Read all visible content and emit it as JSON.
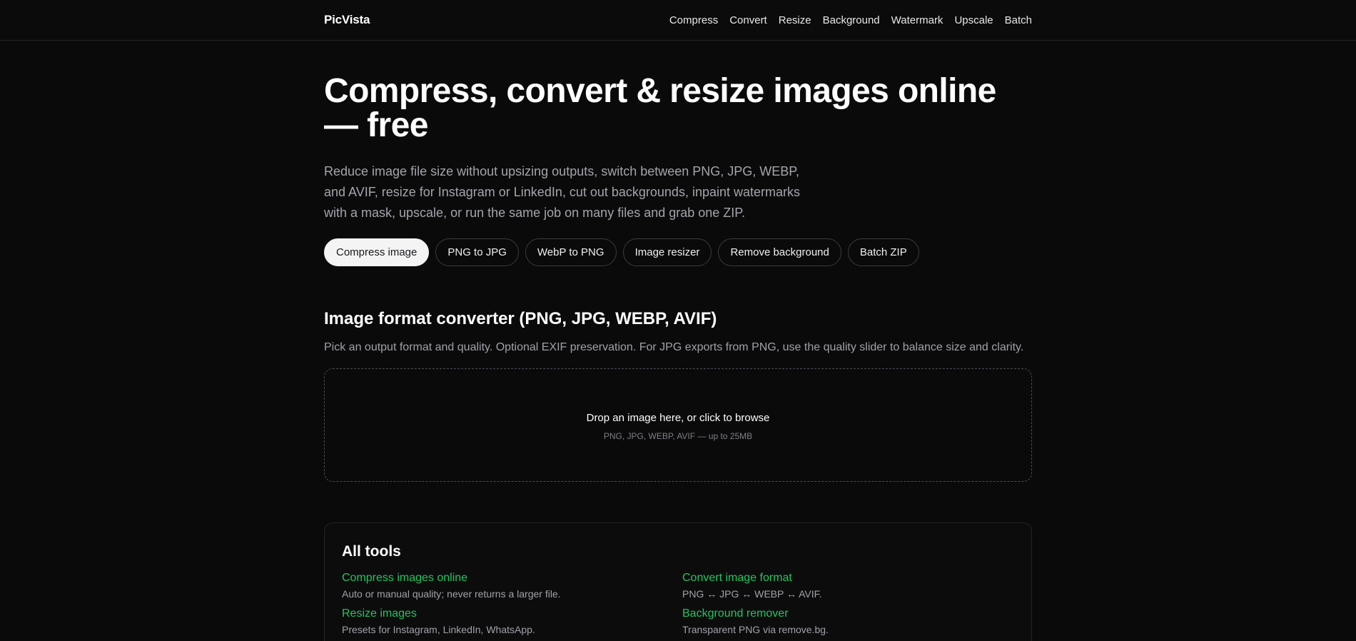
{
  "header": {
    "brand": "PicVista",
    "nav": [
      "Compress",
      "Convert",
      "Resize",
      "Background",
      "Watermark",
      "Upscale",
      "Batch"
    ]
  },
  "hero": {
    "title": "Compress, convert & resize images online — free",
    "subtitle": "Reduce image file size without upsizing outputs, switch between PNG, JPG, WEBP, and AVIF, resize for Instagram or LinkedIn, cut out backgrounds, inpaint watermarks with a mask, upscale, or run the same job on many files and grab one ZIP.",
    "pills": [
      "Compress image",
      "PNG to JPG",
      "WebP to PNG",
      "Image resizer",
      "Remove background",
      "Batch ZIP"
    ],
    "active_pill": "Compress image"
  },
  "converter": {
    "title": "Image format converter (PNG, JPG, WEBP, AVIF)",
    "description": "Pick an output format and quality. Optional EXIF preservation. For JPG exports from PNG, use the quality slider to balance size and clarity.",
    "dropzone_label": "Drop an image here, or click to browse",
    "dropzone_hint": "PNG, JPG, WEBP, AVIF — up to 25MB"
  },
  "all_tools": {
    "title": "All tools",
    "items": [
      {
        "name": "Compress images online",
        "desc": "Auto or manual quality; never returns a larger file."
      },
      {
        "name": "Convert image format",
        "desc": "PNG ↔ JPG ↔ WEBP ↔ AVIF."
      },
      {
        "name": "Resize images",
        "desc": "Presets for Instagram, LinkedIn, WhatsApp."
      },
      {
        "name": "Background remover",
        "desc": "Transparent PNG via remove.bg."
      }
    ]
  },
  "colors": {
    "background": "#0a0a0b",
    "accent_link": "#22c55e",
    "active_pill_bg": "#f4f4f5"
  }
}
